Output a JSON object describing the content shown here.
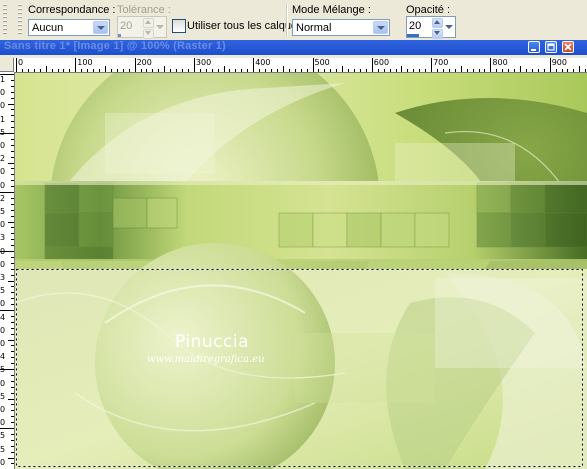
{
  "toolbar": {
    "match_mode_label": "Correspondance :",
    "match_mode_value": "Aucun",
    "tolerance_label": "Tolérance :",
    "tolerance_value": "20",
    "use_all_layers_label": "Utiliser tous les calques",
    "blend_mode_label": "Mode Mélange :",
    "blend_mode_value": "Normal",
    "opacity_label": "Opacité :",
    "opacity_value": "20"
  },
  "window": {
    "title": "Sans titre 1* [Image 1] @ 100% (Raster 1)"
  },
  "ruler": {
    "h_labels": [
      "0",
      "100",
      "200",
      "300",
      "400",
      "500",
      "600",
      "700",
      "800",
      "900"
    ],
    "v_labels": [
      "1",
      "0",
      "0",
      "1",
      "5",
      "0",
      "2",
      "0",
      "0",
      "2",
      "5",
      "0",
      "3",
      "0",
      "0",
      "3",
      "5",
      "0",
      "4",
      "0",
      "0",
      "4",
      "5",
      "0",
      "5",
      "0",
      "0",
      "5",
      "5",
      "0"
    ]
  },
  "canvas": {
    "watermark_name": "Pinuccia",
    "watermark_url": "www.maidiregrafica.eu"
  },
  "colors": {
    "title_bar": "#2a5bd6",
    "canvas_light": "#dfe9a8",
    "canvas_dark": "#4a6e22",
    "selection_marquee": "#000000"
  }
}
